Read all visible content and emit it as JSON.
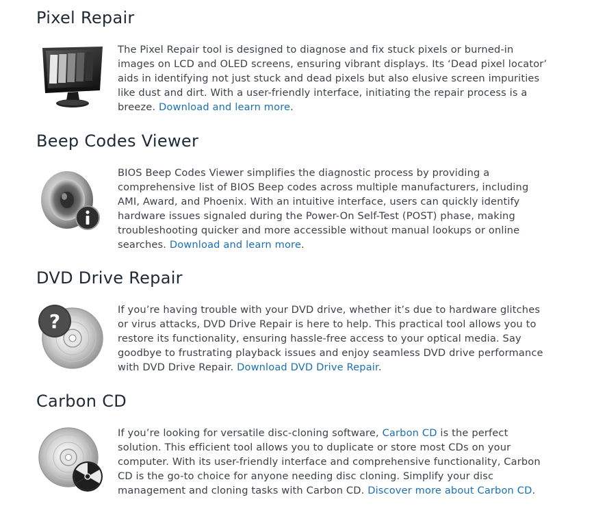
{
  "sections": [
    {
      "title": "Pixel Repair",
      "icon": "monitor-icon",
      "lines": [
        "The Pixel Repair tool is designed to diagnose and fix stuck pixels or burned-in",
        "images on LCD and OLED screens, ensuring vibrant displays. Its ‘Dead pixel locator’",
        "aids in identifying not just stuck and dead pixels but also elusive screen impurities",
        "like dust and dirt. With a user-friendly interface, initiating the repair process is a"
      ],
      "last_before": "breeze. ",
      "link": "Download and learn more",
      "last_after": "."
    },
    {
      "title": "Beep Codes Viewer",
      "icon": "speaker-info-icon",
      "lines": [
        "BIOS Beep Codes Viewer simplifies the diagnostic process by providing a",
        "comprehensive list of BIOS Beep codes across multiple manufacturers, including",
        "AMI, Award, and Phoenix. With an intuitive interface, users can quickly identify",
        "hardware issues signaled during the Power-On Self-Test (POST) phase, making",
        "troubleshooting quicker and more accessible without manual lookups or online"
      ],
      "last_before": "searches. ",
      "link": "Download and learn more",
      "last_after": "."
    },
    {
      "title": "DVD Drive Repair",
      "icon": "disc-question-icon",
      "lines": [
        "If you’re having trouble with your DVD drive, whether it’s due to hardware glitches",
        "or virus attacks, DVD Drive Repair is here to help. This practical tool allows you to",
        "restore its functionality, ensuring hassle-free access to your optical media. Say",
        "goodbye to frustrating playback issues and enjoy seamless DVD drive performance"
      ],
      "last_before": "with DVD Drive Repair. ",
      "link": "Download DVD Drive Repair",
      "last_after": "."
    },
    {
      "title": "Carbon CD",
      "icon": "disc-radiation-icon",
      "first_before": "If you’re looking for versatile disc-cloning software, ",
      "first_link": "Carbon CD",
      "first_after": " is the perfect",
      "lines": [
        "solution. This efficient tool allows you to duplicate or store most CDs on your",
        "computer. With its user-friendly interface and comprehensive functionality, Carbon",
        "CD is the go-to choice for anyone needing disc cloning. Simplify your disc"
      ],
      "last_before": "management and cloning tasks with Carbon CD. ",
      "link": "Discover more about Carbon CD",
      "last_after": "."
    }
  ]
}
